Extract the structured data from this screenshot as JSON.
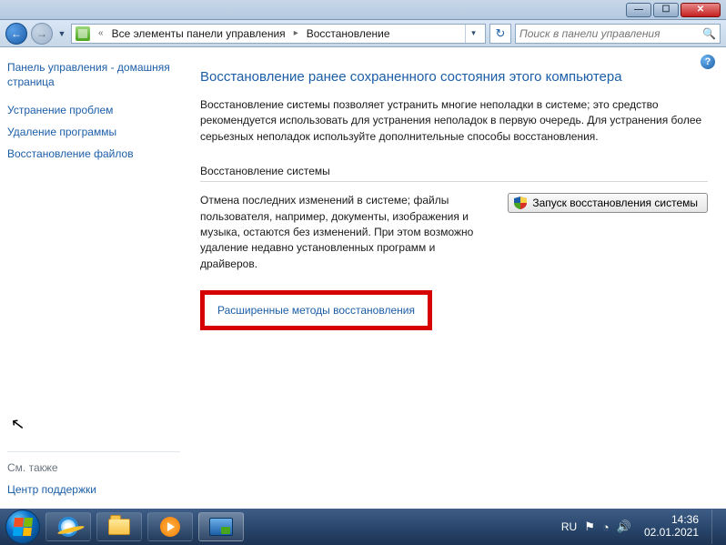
{
  "window": {
    "breadcrumb": {
      "root": "Все элементы панели управления",
      "current": "Восстановление"
    },
    "search_placeholder": "Поиск в панели управления"
  },
  "sidebar": {
    "home": "Панель управления - домашняя страница",
    "links": [
      "Устранение проблем",
      "Удаление программы",
      "Восстановление файлов"
    ]
  },
  "main": {
    "title": "Восстановление ранее сохраненного состояния этого компьютера",
    "description": "Восстановление системы позволяет устранить многие неполадки в системе; это средство рекомендуется использовать для устранения неполадок в первую очередь. Для устранения более серьезных неполадок используйте дополнительные способы восстановления.",
    "section_heading": "Восстановление системы",
    "restore_text": "Отмена последних изменений в системе; файлы пользователя, например, документы, изображения и музыка, остаются без изменений. При этом возможно удаление недавно установленных программ и драйверов.",
    "restore_button": "Запуск восстановления системы",
    "advanced_link": "Расширенные методы восстановления"
  },
  "see_also": {
    "label": "См. также",
    "link": "Центр поддержки"
  },
  "tray": {
    "lang": "RU",
    "time": "14:36",
    "date": "02.01.2021"
  }
}
